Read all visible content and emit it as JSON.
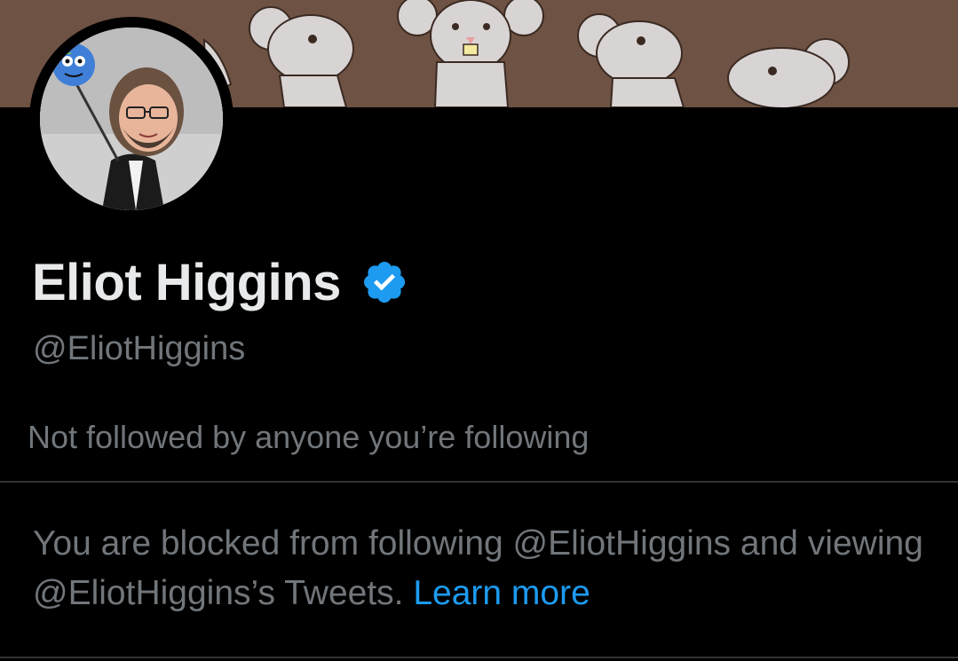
{
  "profile": {
    "display_name": "Eliot Higgins",
    "handle": "@EliotHiggins",
    "verified": true,
    "verified_icon": "verified-badge-icon",
    "followers_note": "Not followed by anyone you’re following"
  },
  "blocked_notice": {
    "text": "You are blocked from following @EliotHiggins and viewing @EliotHiggins’s Tweets.",
    "link_label": "Learn more"
  },
  "colors": {
    "background": "#000000",
    "primary_text": "#e7e9ea",
    "secondary_text": "#71767b",
    "accent": "#1d9bf0",
    "divider": "#2f3336"
  }
}
